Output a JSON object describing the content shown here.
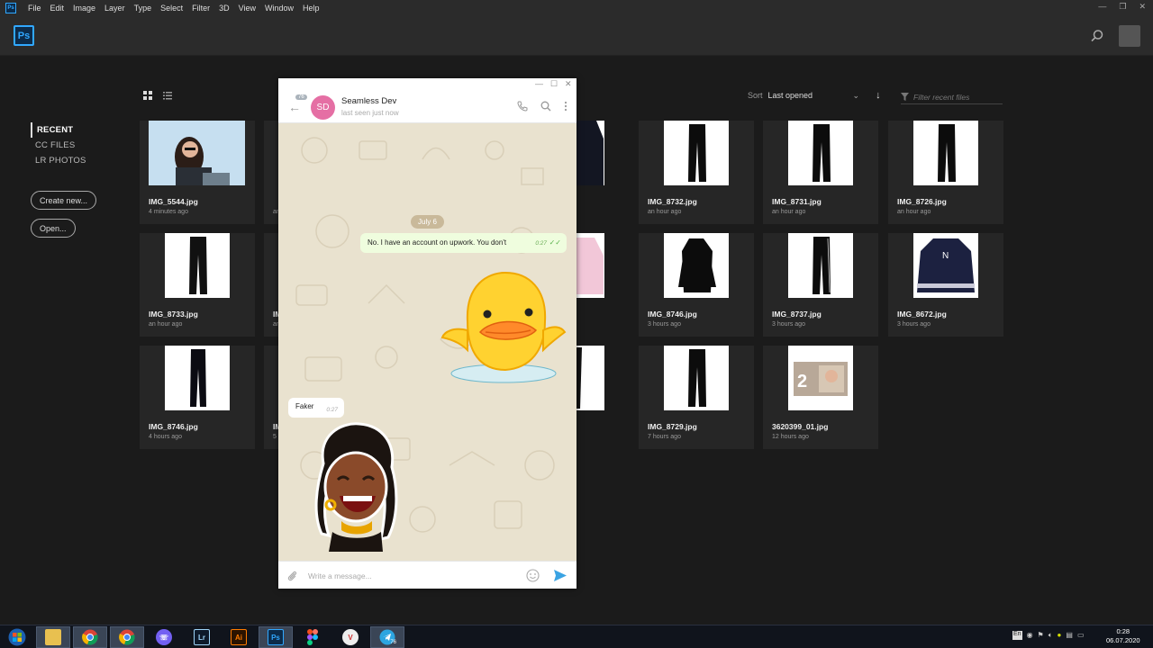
{
  "menubar": {
    "app_icon": "Ps",
    "items": [
      "File",
      "Edit",
      "Image",
      "Layer",
      "Type",
      "Select",
      "Filter",
      "3D",
      "View",
      "Window",
      "Help"
    ]
  },
  "topbar": {
    "logo": "Ps"
  },
  "leftnav": {
    "items": [
      {
        "label": "RECENT",
        "active": true
      },
      {
        "label": "CC FILES",
        "active": false
      },
      {
        "label": "LR PHOTOS",
        "active": false
      }
    ],
    "create_new": "Create new...",
    "open": "Open..."
  },
  "toolbar": {
    "sort_label": "Sort",
    "sort_value": "Last opened",
    "filter_placeholder": "Filter recent files"
  },
  "files": [
    {
      "name": "IMG_5544.jpg",
      "time": "4 minutes ago"
    },
    {
      "name": "IMG_8732.jpg",
      "time": "an hour ago"
    },
    {
      "name": "IMG_8731.jpg",
      "time": "an hour ago"
    },
    {
      "name": "IMG_8726.jpg",
      "time": "an hour ago"
    },
    {
      "name": "IMG_8733.jpg",
      "time": "an hour ago"
    },
    {
      "name": "IMG_8746.jpg",
      "time": "3 hours ago"
    },
    {
      "name": "IMG_8737.jpg",
      "time": "3 hours ago"
    },
    {
      "name": "IMG_8672.jpg",
      "time": "3 hours ago"
    },
    {
      "name": "IMG_8746.jpg",
      "time": "4 hours ago"
    },
    {
      "name": "IMG_8729.jpg",
      "time": "7 hours ago"
    },
    {
      "name": "3620399_01.jpg",
      "time": "12 hours ago"
    }
  ],
  "partial_labels": {
    "col2_row1_time": "an",
    "col2_row2_name": "IM",
    "col2_row2_time": "an",
    "col2_row3_name": "IM",
    "col2_row3_time": "5"
  },
  "telegram": {
    "back_badge": "76",
    "avatar_initials": "SD",
    "contact_name": "Seamless Dev",
    "contact_status": "last seen just now",
    "date_divider": "July 6",
    "outgoing_message": {
      "text": "No. I have an account on upwork. You don't",
      "time": "0:27"
    },
    "incoming_message": {
      "text": "Faker",
      "time": "0:27"
    },
    "input_placeholder": "Write a message..."
  },
  "taskbar": {
    "telegram_badge": "76",
    "clock_time": "0:28",
    "clock_date": "06.07.2020",
    "lang": "En"
  },
  "colors": {
    "ps_blue": "#31a8ff",
    "avatar_pink": "#e56fa4",
    "telegram_blue": "#3aa3e3",
    "outgoing_bubble": "#effdde"
  }
}
